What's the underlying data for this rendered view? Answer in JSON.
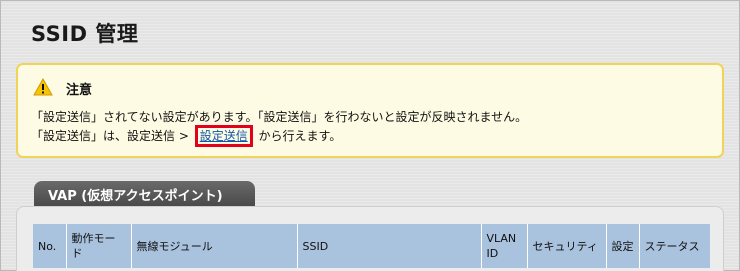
{
  "page": {
    "title": "SSID 管理"
  },
  "notice": {
    "title": "注意",
    "line1": "「設定送信」されてない設定があります。「設定送信」を行わないと設定が反映されません。",
    "line2_prefix": "「設定送信」は、設定送信 > ",
    "line2_link": "設定送信",
    "line2_suffix": " から行えます。",
    "icon": "warning-icon",
    "colors": {
      "border": "#f0d35a",
      "background": "#fdfbe3",
      "link_highlight": "#e2001a"
    }
  },
  "vap": {
    "tab_label": "VAP (仮想アクセスポイント)",
    "columns": [
      "No.",
      "動作モード",
      "無線モジュール",
      "SSID",
      "VLAN ID",
      "セキュリティ",
      "設定",
      "ステータス"
    ]
  }
}
